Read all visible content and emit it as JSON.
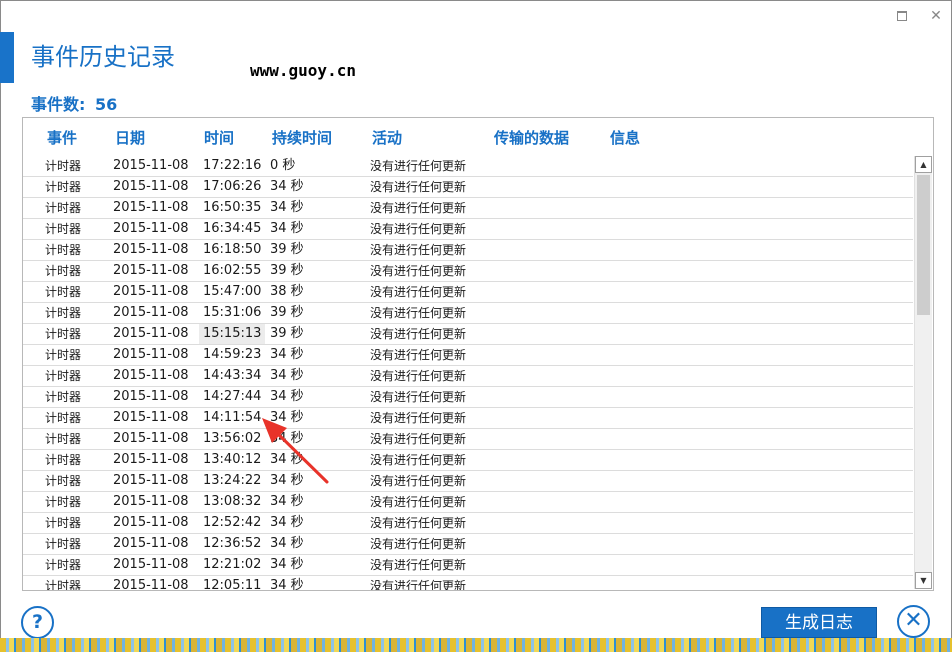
{
  "window": {
    "title": "事件历史记录",
    "watermark": "www.guoy.cn",
    "maximize_label": "",
    "close_label": "✕"
  },
  "summary": {
    "label": "事件数:",
    "value": "56"
  },
  "table": {
    "headers": [
      "事件",
      "日期",
      "时间",
      "持续时间",
      "活动",
      "传输的数据",
      "信息"
    ],
    "rows": [
      [
        "计时器",
        "2015-11-08",
        "17:22:16",
        "0 秒",
        "没有进行任何更新"
      ],
      [
        "计时器",
        "2015-11-08",
        "17:06:26",
        "34 秒",
        "没有进行任何更新"
      ],
      [
        "计时器",
        "2015-11-08",
        "16:50:35",
        "34 秒",
        "没有进行任何更新"
      ],
      [
        "计时器",
        "2015-11-08",
        "16:34:45",
        "34 秒",
        "没有进行任何更新"
      ],
      [
        "计时器",
        "2015-11-08",
        "16:18:50",
        "39 秒",
        "没有进行任何更新"
      ],
      [
        "计时器",
        "2015-11-08",
        "16:02:55",
        "39 秒",
        "没有进行任何更新"
      ],
      [
        "计时器",
        "2015-11-08",
        "15:47:00",
        "38 秒",
        "没有进行任何更新"
      ],
      [
        "计时器",
        "2015-11-08",
        "15:31:06",
        "39 秒",
        "没有进行任何更新"
      ],
      [
        "计时器",
        "2015-11-08",
        "15:15:13",
        "39 秒",
        "没有进行任何更新"
      ],
      [
        "计时器",
        "2015-11-08",
        "14:59:23",
        "34 秒",
        "没有进行任何更新"
      ],
      [
        "计时器",
        "2015-11-08",
        "14:43:34",
        "34 秒",
        "没有进行任何更新"
      ],
      [
        "计时器",
        "2015-11-08",
        "14:27:44",
        "34 秒",
        "没有进行任何更新"
      ],
      [
        "计时器",
        "2015-11-08",
        "14:11:54",
        "34 秒",
        "没有进行任何更新"
      ],
      [
        "计时器",
        "2015-11-08",
        "13:56:02",
        "34 秒",
        "没有进行任何更新"
      ],
      [
        "计时器",
        "2015-11-08",
        "13:40:12",
        "34 秒",
        "没有进行任何更新"
      ],
      [
        "计时器",
        "2015-11-08",
        "13:24:22",
        "34 秒",
        "没有进行任何更新"
      ],
      [
        "计时器",
        "2015-11-08",
        "13:08:32",
        "34 秒",
        "没有进行任何更新"
      ],
      [
        "计时器",
        "2015-11-08",
        "12:52:42",
        "34 秒",
        "没有进行任何更新"
      ],
      [
        "计时器",
        "2015-11-08",
        "12:36:52",
        "34 秒",
        "没有进行任何更新"
      ],
      [
        "计时器",
        "2015-11-08",
        "12:21:02",
        "34 秒",
        "没有进行任何更新"
      ],
      [
        "计时器",
        "2015-11-08",
        "12:05:11",
        "34 秒",
        "没有进行任何更新"
      ]
    ],
    "highlighted_row": 8
  },
  "footer": {
    "help_label": "?",
    "generate_log_label": "生成日志",
    "close_label": "✕"
  },
  "colors": {
    "accent": "#1871c6",
    "arrow": "#e8332a"
  },
  "icons": {
    "help": "question-circle-icon",
    "close": "close-circle-icon",
    "annotation": "red-arrow-annotation"
  }
}
